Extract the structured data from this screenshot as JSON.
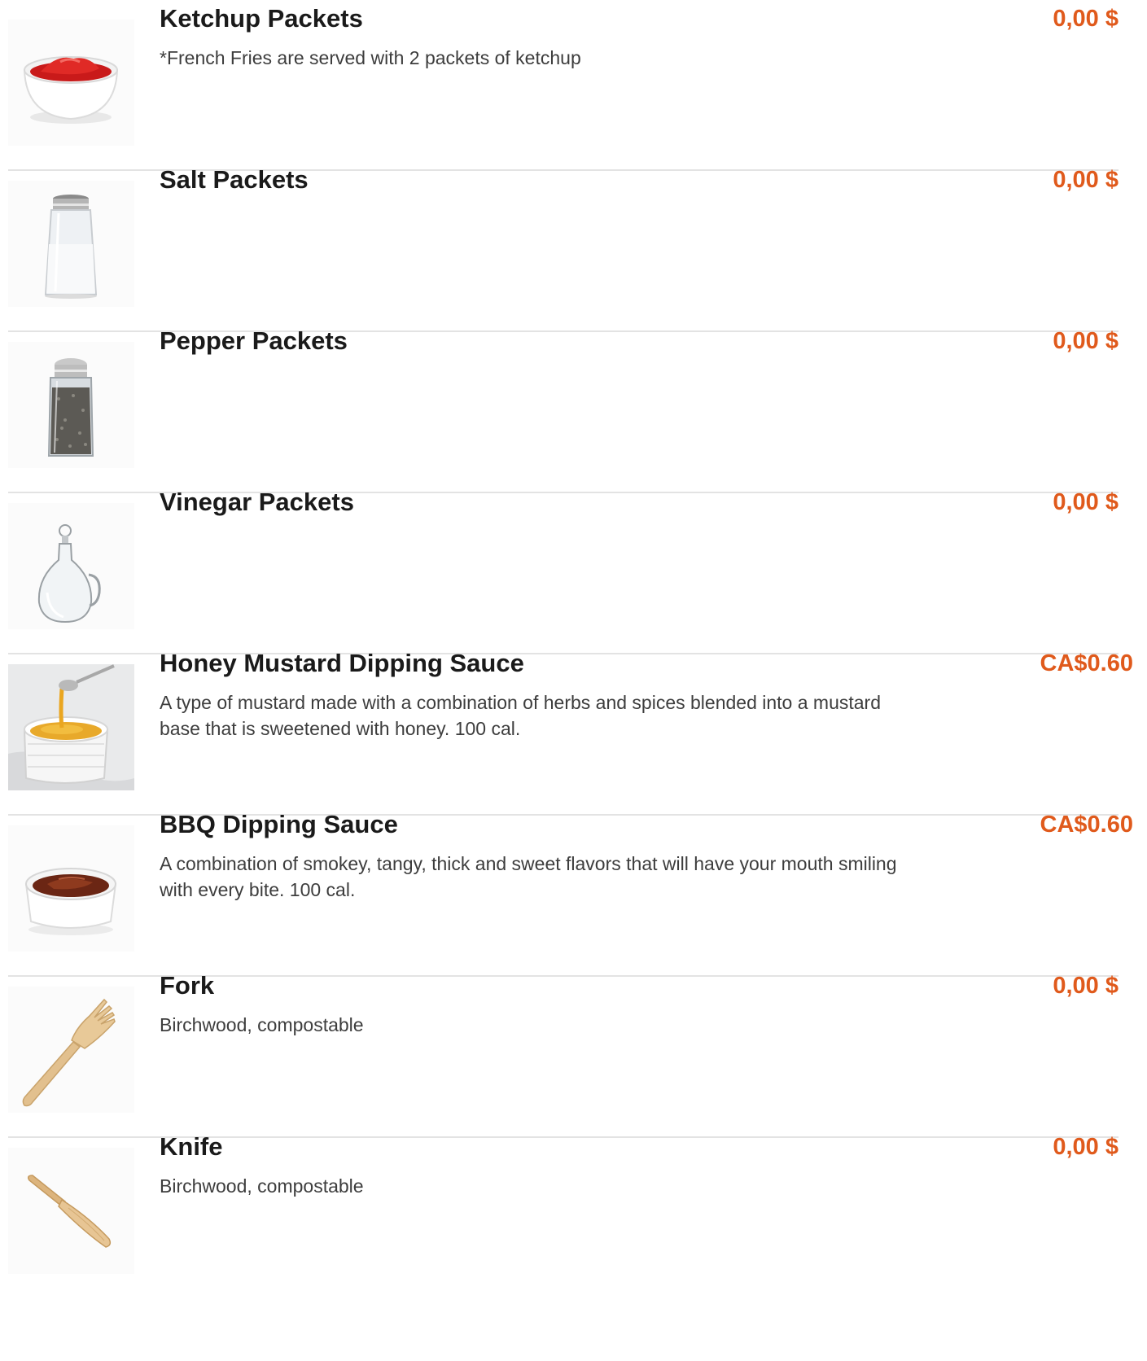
{
  "items": [
    {
      "name": "Ketchup Packets",
      "description": "*French Fries are served with 2 packets of ketchup",
      "price": "0,00 $",
      "image": "ketchup-bowl"
    },
    {
      "name": "Salt Packets",
      "description": "",
      "price": "0,00 $",
      "image": "salt-shaker"
    },
    {
      "name": "Pepper Packets",
      "description": "",
      "price": "0,00 $",
      "image": "pepper-shaker"
    },
    {
      "name": "Vinegar Packets",
      "description": "",
      "price": "0,00 $",
      "image": "vinegar-cruet"
    },
    {
      "name": "Honey Mustard Dipping Sauce",
      "description": "A type of mustard made with a combination of herbs and spices blended into a mustard base that is sweetened with honey. 100 cal.",
      "price": "CA$0.60",
      "image": "honey-mustard-cup"
    },
    {
      "name": "BBQ Dipping Sauce",
      "description": "A combination of smokey, tangy, thick and sweet flavors that will have your mouth smiling with every bite. 100 cal.",
      "price": "CA$0.60",
      "image": "bbq-sauce-cup"
    },
    {
      "name": "Fork",
      "description": "Birchwood, compostable",
      "price": "0,00 $",
      "image": "wooden-fork"
    },
    {
      "name": "Knife",
      "description": "Birchwood, compostable",
      "price": "0,00 $",
      "image": "wooden-knife"
    }
  ],
  "colors": {
    "price": "#e05a1c",
    "divider": "#e3e3e3",
    "title": "#1a1a1a",
    "description": "#3d3d3d"
  }
}
